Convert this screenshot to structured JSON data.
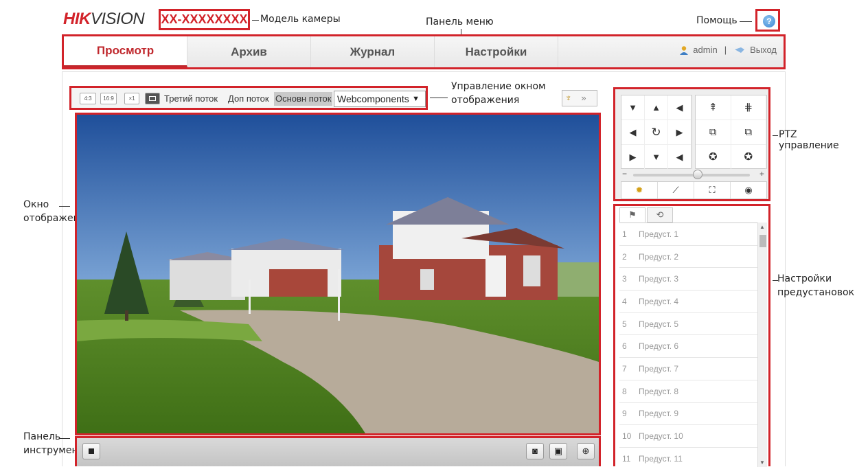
{
  "header": {
    "logo_hik": "HIK",
    "logo_vision": "VISION",
    "model": "XX-XXXXXXXX",
    "help_icon": "?"
  },
  "annotations": {
    "model": "Модель камеры",
    "menu_panel": "Панель меню",
    "help": "Помощь",
    "view_control_line1": "Управление окном",
    "view_control_line2": "отображения",
    "ptz": "PTZ управление",
    "display_window_line1": "Окно",
    "display_window_line2": "отображения",
    "preset_line1": "Настройки",
    "preset_line2": "предустановок",
    "toolbar_line1": "Панель",
    "toolbar_line2": "инструментов"
  },
  "menu": {
    "tabs": [
      "Просмотр",
      "Архив",
      "Журнал",
      "Настройки"
    ],
    "user": "admin",
    "separator": "|",
    "logout": "Выход"
  },
  "view_toolbar": {
    "ratio_4_3": "4:3",
    "ratio_16_9": "16:9",
    "ratio_x1": "×1",
    "streams": [
      "Третий поток",
      "Доп поток",
      "Основн поток"
    ],
    "plugin_select": "Webcomponents",
    "ptz_toggle_chevron": "»"
  },
  "ptz": {
    "directions": [
      "▼",
      "▲",
      "◄",
      "◄",
      "⟳",
      "►",
      "►",
      "▼",
      "◄"
    ],
    "zoom_focus_icons": [
      "zoom-in-icon",
      "zoom-out-icon",
      "focus-near-icon",
      "focus-far-icon",
      "iris-open-icon",
      "iris-close-icon"
    ],
    "speed_minus": "−",
    "speed_plus": "+",
    "speed_level": 0.55
  },
  "presets": {
    "items": [
      {
        "num": "1",
        "name": "Предуст. 1"
      },
      {
        "num": "2",
        "name": "Предуст. 2"
      },
      {
        "num": "3",
        "name": "Предуст. 3"
      },
      {
        "num": "4",
        "name": "Предуст. 4"
      },
      {
        "num": "5",
        "name": "Предуст. 5"
      },
      {
        "num": "6",
        "name": "Предуст. 6"
      },
      {
        "num": "7",
        "name": "Предуст. 7"
      },
      {
        "num": "8",
        "name": "Предуст. 8"
      },
      {
        "num": "9",
        "name": "Предуст. 9"
      },
      {
        "num": "10",
        "name": "Предуст. 10"
      },
      {
        "num": "11",
        "name": "Предуст. 11"
      }
    ]
  },
  "colors": {
    "highlight_red": "#d2232a",
    "active_tab": "#c0282d"
  }
}
